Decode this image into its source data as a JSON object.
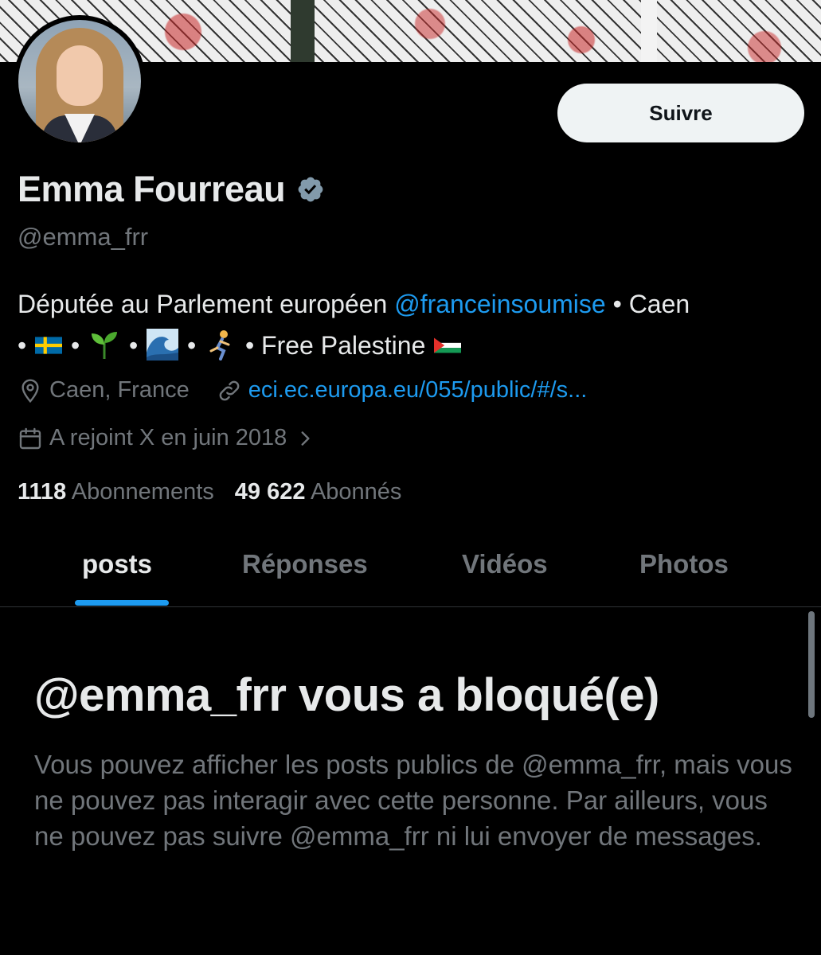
{
  "profile": {
    "name": "Emma Fourreau",
    "handle": "@emma_frr",
    "follow_label": "Suivre",
    "bio": {
      "prefix": "Députée au Parlement européen ",
      "mention": "@franceinsoumise",
      "suffix1": " • Caen",
      "sep": " • ",
      "free_palestine": " • Free Palestine "
    },
    "location": "Caen, France",
    "website": "eci.ec.europa.eu/055/public/#/s...",
    "joined": "A rejoint X en juin 2018",
    "following_count": "1118",
    "following_label": "Abonnements",
    "followers_count": "49 622",
    "followers_label": "Abonnés"
  },
  "tabs": [
    {
      "label": "posts",
      "active": true
    },
    {
      "label": "Réponses",
      "active": false
    },
    {
      "label": "Vidéos",
      "active": false
    },
    {
      "label": "Photos",
      "active": false
    }
  ],
  "blocked": {
    "title": "@emma_frr vous a bloqué(e)",
    "message": "Vous pouvez afficher les posts publics de @emma_frr, mais vous ne pouvez pas interagir avec cette personne. Par ailleurs, vous ne pouvez pas suivre @emma_frr ni lui envoyer de messages."
  },
  "icons": {
    "verified": "verified-badge-icon",
    "location": "location-pin-icon",
    "link": "link-icon",
    "calendar": "calendar-icon",
    "chevron": "chevron-right-icon"
  },
  "colors": {
    "background": "#000000",
    "text": "#e7e9ea",
    "muted": "#71767b",
    "accent": "#1d9bf0",
    "button_bg": "#eff3f4"
  }
}
